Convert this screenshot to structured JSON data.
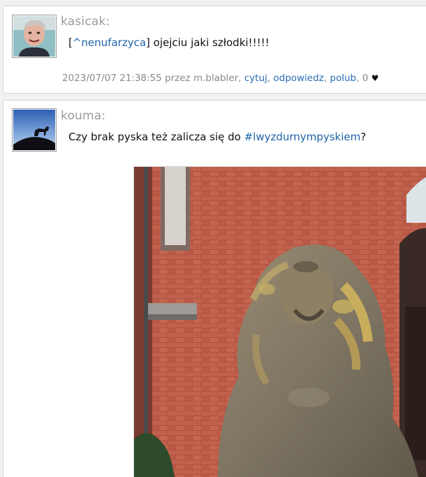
{
  "posts": [
    {
      "author": "kasicak:",
      "reply_open": "[",
      "mention": "^nenufarzyca",
      "reply_close": "]",
      "text": " ojejciu jaki szłodki!!!!!",
      "meta": {
        "datetime": "2023/07/07 21:38:55",
        "by_label": "przez",
        "user": "m.blabler",
        "sep": ",",
        "quote_label": "cytuj",
        "reply_label": "odpowiedz",
        "like_label": "polub",
        "likes": "0",
        "heart": "♥"
      }
    },
    {
      "author": "kouma:",
      "text_before": "Czy brak pyska też zalicza się do ",
      "hashtag": "#lwyzdurnympyskiem",
      "text_after": "?"
    }
  ],
  "colors": {
    "link": "#1f63a8",
    "author": "#9b9b9b",
    "brick": "#b85a48"
  }
}
